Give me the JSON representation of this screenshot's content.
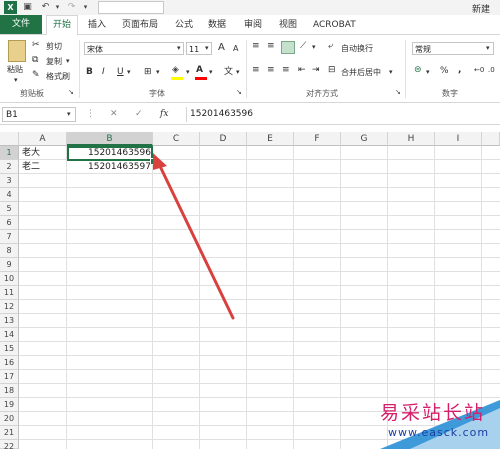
{
  "titlebar": {
    "new_label": "新建"
  },
  "tabs": [
    {
      "label": "文件"
    },
    {
      "label": "开始"
    },
    {
      "label": "插入"
    },
    {
      "label": "页面布局"
    },
    {
      "label": "公式"
    },
    {
      "label": "数据"
    },
    {
      "label": "审阅"
    },
    {
      "label": "视图"
    },
    {
      "label": "ACROBAT"
    }
  ],
  "ribbon": {
    "clipboard": {
      "paste": "粘贴",
      "cut": "剪切",
      "copy": "复制",
      "format_painter": "格式刷",
      "group": "剪贴板"
    },
    "font": {
      "name": "宋体",
      "size": "11",
      "grow": "A",
      "shrink": "A",
      "bold": "B",
      "italic": "I",
      "underline": "U",
      "font_color_glyph": "A",
      "phonetic": "文",
      "group": "字体"
    },
    "alignment": {
      "wrap": "自动换行",
      "merge": "合并后居中",
      "group": "对齐方式"
    },
    "number": {
      "format": "常规",
      "percent": "%",
      "comma": ",",
      "group": "数字"
    }
  },
  "formula": {
    "namebox": "B1",
    "cancel": "✕",
    "enter": "✓",
    "fx": "fx",
    "value": "15201463596"
  },
  "grid": {
    "columns": [
      "A",
      "B",
      "C",
      "D",
      "E",
      "F",
      "G",
      "H",
      "I"
    ],
    "rows": [
      "1",
      "2",
      "3",
      "4",
      "5",
      "6",
      "7",
      "8",
      "9",
      "10",
      "11",
      "12",
      "13",
      "14",
      "15",
      "16",
      "17",
      "18",
      "19",
      "20",
      "21",
      "22"
    ],
    "cells": [
      {
        "a": "老大",
        "b": "15201463596"
      },
      {
        "a": "老二",
        "b": "15201463597"
      }
    ]
  },
  "watermark": {
    "cn": "易采站长站",
    "url": "www.easck.com"
  },
  "colors": {
    "accent": "#217346",
    "arrow": "#d9413f"
  }
}
